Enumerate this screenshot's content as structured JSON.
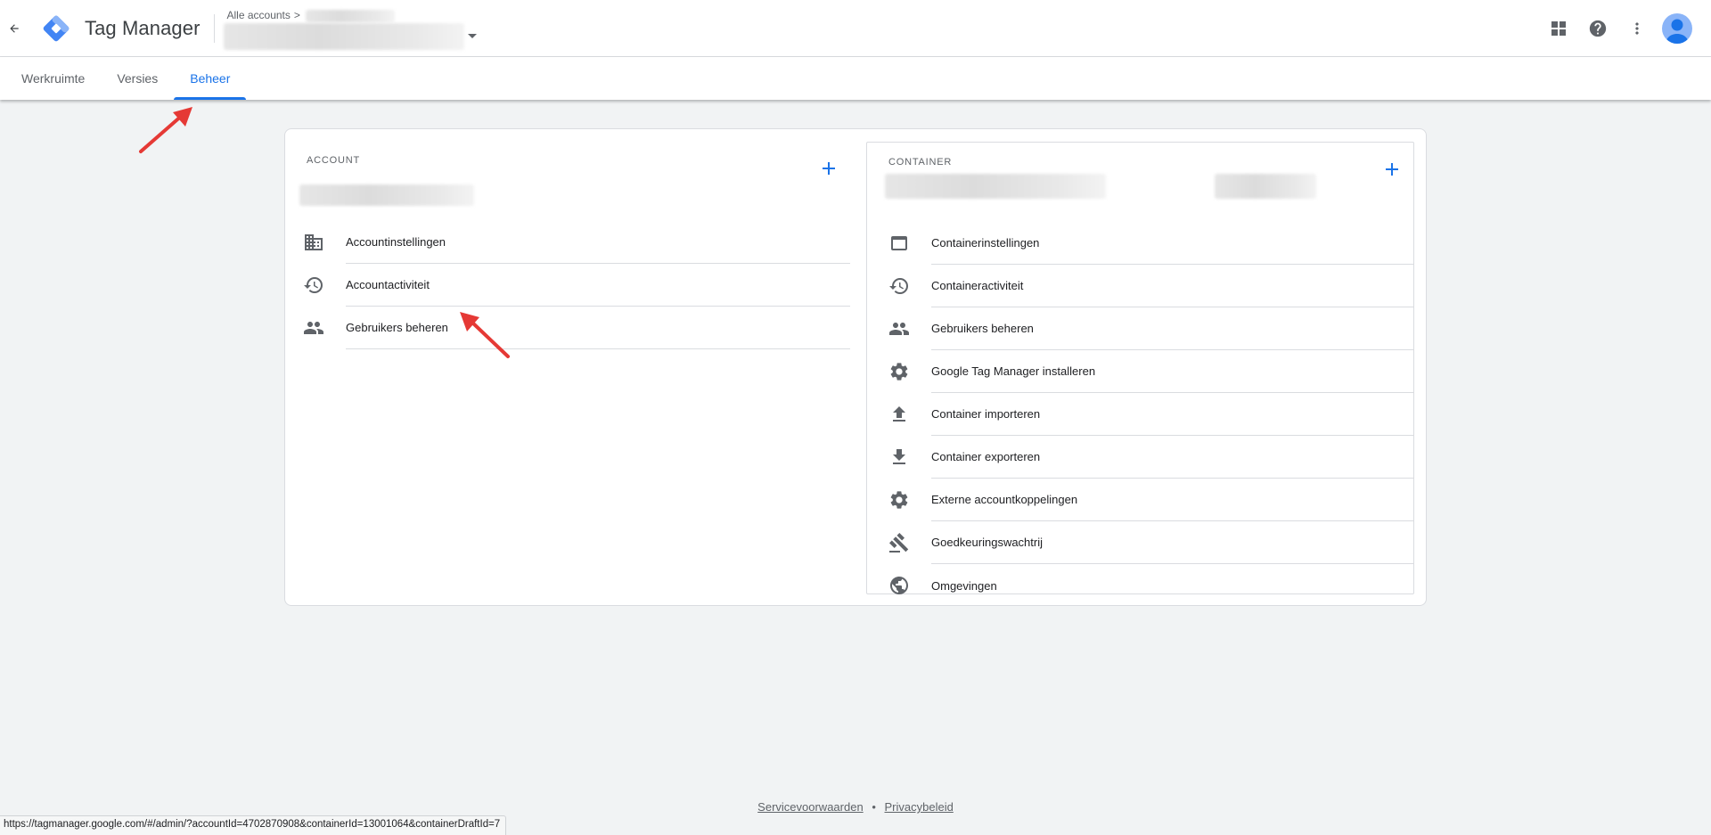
{
  "topbar": {
    "app_title": "Tag Manager",
    "breadcrumb": "Alle accounts",
    "breadcrumb_sep": ">",
    "icons": [
      "back-arrow-icon",
      "tag-manager-logo",
      "apps-grid-icon",
      "help-icon",
      "more-vert-icon",
      "account-avatar"
    ]
  },
  "tabs": [
    {
      "label": "Werkruimte",
      "active": false
    },
    {
      "label": "Versies",
      "active": false
    },
    {
      "label": "Beheer",
      "active": true
    }
  ],
  "account": {
    "heading": "ACCOUNT",
    "add_symbol": "+",
    "items": [
      {
        "label": "Accountinstellingen",
        "icon": "business-icon"
      },
      {
        "label": "Accountactiviteit",
        "icon": "history-icon"
      },
      {
        "label": "Gebruikers beheren",
        "icon": "people-icon"
      }
    ]
  },
  "container": {
    "heading": "CONTAINER",
    "add_symbol": "+",
    "items": [
      {
        "label": "Containerinstellingen",
        "icon": "web-asset-icon"
      },
      {
        "label": "Containeractiviteit",
        "icon": "history-icon"
      },
      {
        "label": "Gebruikers beheren",
        "icon": "people-icon"
      },
      {
        "label": "Google Tag Manager installeren",
        "icon": "settings-icon"
      },
      {
        "label": "Container importeren",
        "icon": "upload-icon"
      },
      {
        "label": "Container exporteren",
        "icon": "download-icon"
      },
      {
        "label": "Externe accountkoppelingen",
        "icon": "settings-icon"
      },
      {
        "label": "Goedkeuringswachtrij",
        "icon": "gavel-icon"
      },
      {
        "label": "Omgevingen",
        "icon": "public-icon"
      }
    ]
  },
  "footer": {
    "terms": "Servicevoorwaarden",
    "separator": "•",
    "privacy": "Privacybeleid"
  },
  "status_url": "https://tagmanager.google.com/#/admin/?accountId=4702870908&containerId=13001064&containerDraftId=7",
  "colors": {
    "accent": "#1a73e8",
    "background": "#f1f3f4",
    "annotation_arrow": "#e53935"
  }
}
